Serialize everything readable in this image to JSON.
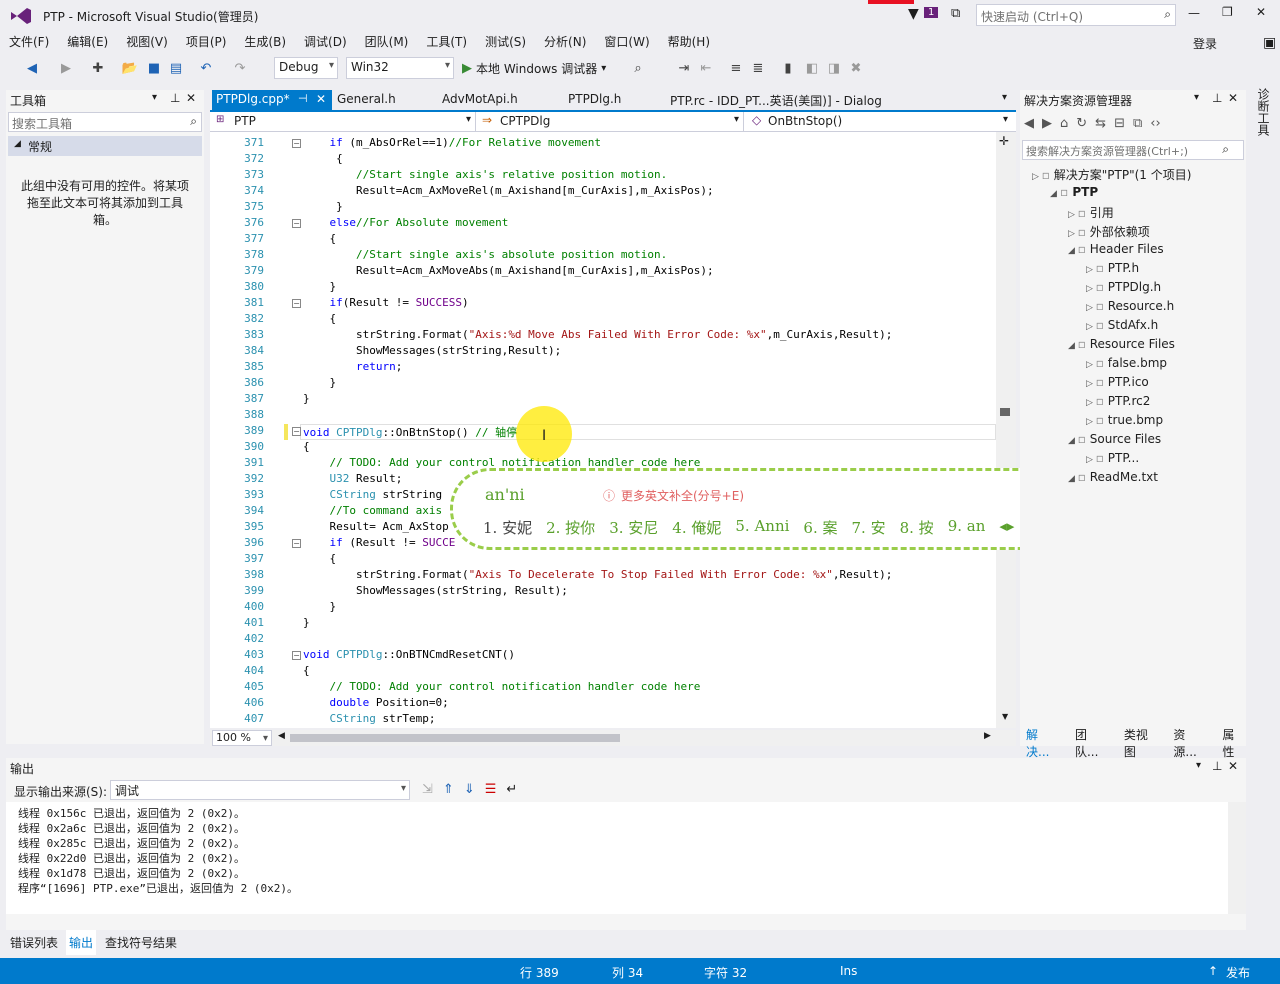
{
  "window": {
    "title": "PTP - Microsoft Visual Studio(管理员)",
    "notif_count": "1",
    "quick_launch_placeholder": "快速启动 (Ctrl+Q)",
    "login": "登录"
  },
  "menu": [
    "文件(F)",
    "编辑(E)",
    "视图(V)",
    "项目(P)",
    "生成(B)",
    "调试(D)",
    "团队(M)",
    "工具(T)",
    "测试(S)",
    "分析(N)",
    "窗口(W)",
    "帮助(H)"
  ],
  "toolbar": {
    "config": "Debug",
    "platform": "Win32",
    "run_label": "本地 Windows 调试器"
  },
  "toolbox": {
    "title": "工具箱",
    "search_placeholder": "搜索工具箱",
    "group": "常规",
    "empty_text": "此组中没有可用的控件。将某项拖至此文本可将其添加到工具箱。"
  },
  "tabs": [
    "PTPDlg.cpp*",
    "General.h",
    "AdvMotApi.h",
    "PTPDlg.h",
    "PTP.rc - IDD_PT...英语(美国)] - Dialog"
  ],
  "nav": {
    "project": "PTP",
    "class": "CPTPDlg",
    "member": "OnBtnStop()"
  },
  "code": [
    {
      "n": "371",
      "t": "    if (m_AbsOrRel==1)//For Relative movement"
    },
    {
      "n": "372",
      "t": "     {"
    },
    {
      "n": "373",
      "t": "        //Start single axis's relative position motion."
    },
    {
      "n": "374",
      "t": "        Result=Acm_AxMoveRel(m_Axishand[m_CurAxis],m_AxisPos);"
    },
    {
      "n": "375",
      "t": "     }"
    },
    {
      "n": "376",
      "t": "    else//For Absolute movement"
    },
    {
      "n": "377",
      "t": "    {"
    },
    {
      "n": "378",
      "t": "        //Start single axis's absolute position motion."
    },
    {
      "n": "379",
      "t": "        Result=Acm_AxMoveAbs(m_Axishand[m_CurAxis],m_AxisPos);"
    },
    {
      "n": "380",
      "t": "    }"
    },
    {
      "n": "381",
      "t": "    if(Result != SUCCESS)"
    },
    {
      "n": "382",
      "t": "    {"
    },
    {
      "n": "383",
      "t": "        strString.Format(\"Axis:%d Move Abs Failed With Error Code: %x\",m_CurAxis,Result);"
    },
    {
      "n": "384",
      "t": "        ShowMessages(strString,Result);"
    },
    {
      "n": "385",
      "t": "        return;"
    },
    {
      "n": "386",
      "t": "    }"
    },
    {
      "n": "387",
      "t": "}"
    },
    {
      "n": "388",
      "t": ""
    },
    {
      "n": "389",
      "t": "void CPTPDlg::OnBtnStop() // 轴停"
    },
    {
      "n": "390",
      "t": "{"
    },
    {
      "n": "391",
      "t": "    // TODO: Add your control notification handler code here"
    },
    {
      "n": "392",
      "t": "    U32 Result;"
    },
    {
      "n": "393",
      "t": "    CString strString"
    },
    {
      "n": "394",
      "t": "    //To command axis"
    },
    {
      "n": "395",
      "t": "    Result= Acm_AxStop"
    },
    {
      "n": "396",
      "t": "    if (Result != SUCCE"
    },
    {
      "n": "397",
      "t": "    {"
    },
    {
      "n": "398",
      "t": "        strString.Format(\"Axis To Decelerate To Stop Failed With Error Code: %x\",Result);"
    },
    {
      "n": "399",
      "t": "        ShowMessages(strString, Result);"
    },
    {
      "n": "400",
      "t": "    }"
    },
    {
      "n": "401",
      "t": "}"
    },
    {
      "n": "402",
      "t": ""
    },
    {
      "n": "403",
      "t": "void CPTPDlg::OnBTNCmdResetCNT()"
    },
    {
      "n": "404",
      "t": "{"
    },
    {
      "n": "405",
      "t": "    // TODO: Add your control notification handler code here"
    },
    {
      "n": "406",
      "t": "    double Position=0;"
    },
    {
      "n": "407",
      "t": "    CString strTemp;"
    }
  ],
  "zoom": "100 %",
  "ime": {
    "input": "an'ni",
    "hint": "更多英文补全(分号+E)",
    "candidates": [
      "1. 安妮",
      "2. 按你",
      "3. 安尼",
      "4. 俺妮",
      "5. Anni",
      "6. 案",
      "7. 安",
      "8. 按",
      "9. an"
    ]
  },
  "solution": {
    "title": "解决方案资源管理器",
    "search_placeholder": "搜索解决方案资源管理器(Ctrl+;)",
    "items": [
      {
        "label": "解决方案\"PTP\"(1 个项目)",
        "indent": 0
      },
      {
        "label": "PTP",
        "indent": 1
      },
      {
        "label": "引用",
        "indent": 2
      },
      {
        "label": "外部依赖项",
        "indent": 2
      },
      {
        "label": "Header Files",
        "indent": 2
      },
      {
        "label": "PTP.h",
        "indent": 3
      },
      {
        "label": "PTPDlg.h",
        "indent": 3
      },
      {
        "label": "Resource.h",
        "indent": 3
      },
      {
        "label": "StdAfx.h",
        "indent": 3
      },
      {
        "label": "Resource Files",
        "indent": 2
      },
      {
        "label": "false.bmp",
        "indent": 3
      },
      {
        "label": "PTP.ico",
        "indent": 3
      },
      {
        "label": "PTP.rc2",
        "indent": 3
      },
      {
        "label": "true.bmp",
        "indent": 3
      },
      {
        "label": "Source Files",
        "indent": 2
      },
      {
        "label": "PTP...",
        "indent": 3
      },
      {
        "label": "ReadMe.txt",
        "indent": 2
      }
    ],
    "bottom_tabs": [
      "解决...",
      "团队...",
      "类视图",
      "资源...",
      "属性"
    ]
  },
  "side_strip": "诊断工具",
  "output": {
    "title": "输出",
    "source_label": "显示输出来源(S):",
    "source_value": "调试",
    "lines": [
      "线程 0x156c 已退出，返回值为 2 (0x2)。",
      "线程 0x2a6c 已退出，返回值为 2 (0x2)。",
      "线程 0x285c 已退出，返回值为 2 (0x2)。",
      "线程 0x22d0 已退出，返回值为 2 (0x2)。",
      "线程 0x1d78 已退出，返回值为 2 (0x2)。",
      "程序“[1696] PTP.exe”已退出，返回值为 2 (0x2)。"
    ]
  },
  "bottom_tabs": [
    "错误列表",
    "输出",
    "查找符号结果"
  ],
  "status": {
    "line": "行 389",
    "col": "列 34",
    "ch": "字符 32",
    "ins": "Ins",
    "publish": "发布"
  }
}
